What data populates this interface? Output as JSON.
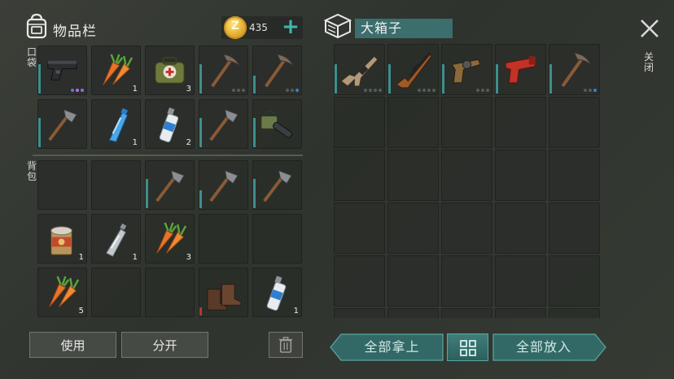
{
  "inventory": {
    "title": "物品栏",
    "coins": "435",
    "add_label": "+",
    "pocket_label": "口袋",
    "backpack_label": "背包",
    "pocket_slots": [
      {
        "icon": "pistol-icon",
        "count": "",
        "dots": [
          "#6a6ff0",
          "#b070e0",
          "#9a6ad8"
        ],
        "dur": "high"
      },
      {
        "icon": "carrot-icon",
        "count": "1",
        "dots": [],
        "dur": ""
      },
      {
        "icon": "medkit-icon",
        "count": "3",
        "dots": [],
        "dur": ""
      },
      {
        "icon": "pickaxe-icon",
        "count": "",
        "dots": [
          "#56595a",
          "#56595a",
          "#56595a"
        ],
        "dur": "high"
      },
      {
        "icon": "pickaxe-icon",
        "count": "",
        "dots": [
          "#56595a",
          "#56595a",
          "#3d7fc8"
        ],
        "dur": "mid"
      },
      {
        "icon": "hatchet-icon",
        "count": "",
        "dots": [],
        "dur": "high"
      },
      {
        "icon": "water-bottle-icon",
        "count": "1",
        "dots": [],
        "dur": ""
      },
      {
        "icon": "spray-can-icon",
        "count": "2",
        "dots": [],
        "dur": ""
      },
      {
        "icon": "hatchet-icon",
        "count": "",
        "dots": [],
        "dur": "high"
      },
      {
        "icon": "chainsaw-icon",
        "count": "",
        "dots": [],
        "dur": "high"
      }
    ],
    "backpack_slots": [
      {
        "icon": "",
        "count": "",
        "dots": [],
        "dur": ""
      },
      {
        "icon": "",
        "count": "",
        "dots": [],
        "dur": ""
      },
      {
        "icon": "hatchet-icon",
        "count": "",
        "dots": [],
        "dur": "high"
      },
      {
        "icon": "hatchet-icon",
        "count": "",
        "dots": [],
        "dur": "mid"
      },
      {
        "icon": "hatchet-icon",
        "count": "",
        "dots": [],
        "dur": "high"
      },
      {
        "icon": "canned-food-icon",
        "count": "1",
        "dots": [],
        "dur": ""
      },
      {
        "icon": "plastic-bottle-icon",
        "count": "1",
        "dots": [],
        "dur": ""
      },
      {
        "icon": "carrot-icon",
        "count": "3",
        "dots": [],
        "dur": ""
      },
      {
        "icon": "",
        "count": "",
        "dots": [],
        "dur": ""
      },
      {
        "icon": "",
        "count": "",
        "dots": [],
        "dur": ""
      },
      {
        "icon": "carrot-icon",
        "count": "5",
        "dots": [],
        "dur": ""
      },
      {
        "icon": "",
        "count": "",
        "dots": [],
        "dur": ""
      },
      {
        "icon": "",
        "count": "",
        "dots": [],
        "dur": ""
      },
      {
        "icon": "boots-icon",
        "count": "",
        "dots": [],
        "dur": "red"
      },
      {
        "icon": "spray-can-icon",
        "count": "1",
        "dots": [],
        "dur": ""
      }
    ],
    "use_button": "使用",
    "split_button": "分开"
  },
  "container": {
    "title": "大箱子",
    "slots": [
      {
        "icon": "assault-rifle-icon",
        "count": "",
        "dots": [
          "#56595a",
          "#56595a",
          "#56595a",
          "#56595a"
        ],
        "dur": "high"
      },
      {
        "icon": "rifle-icon",
        "count": "",
        "dots": [
          "#56595a",
          "#56595a",
          "#56595a",
          "#56595a"
        ],
        "dur": "high"
      },
      {
        "icon": "revolver-icon",
        "count": "",
        "dots": [
          "#56595a",
          "#56595a",
          "#56595a"
        ],
        "dur": "high"
      },
      {
        "icon": "flare-gun-icon",
        "count": "",
        "dots": [],
        "dur": "high"
      },
      {
        "icon": "pickaxe-icon",
        "count": "",
        "dots": [
          "#56595a",
          "#56595a",
          "#3d7fc8"
        ],
        "dur": "high"
      }
    ],
    "take_all_button": "全部拿上",
    "put_all_button": "全部放入",
    "close_label": "关闭"
  },
  "colors": {
    "accent_teal": "#3d8f8e",
    "coin_gold": "#e0a92b"
  }
}
